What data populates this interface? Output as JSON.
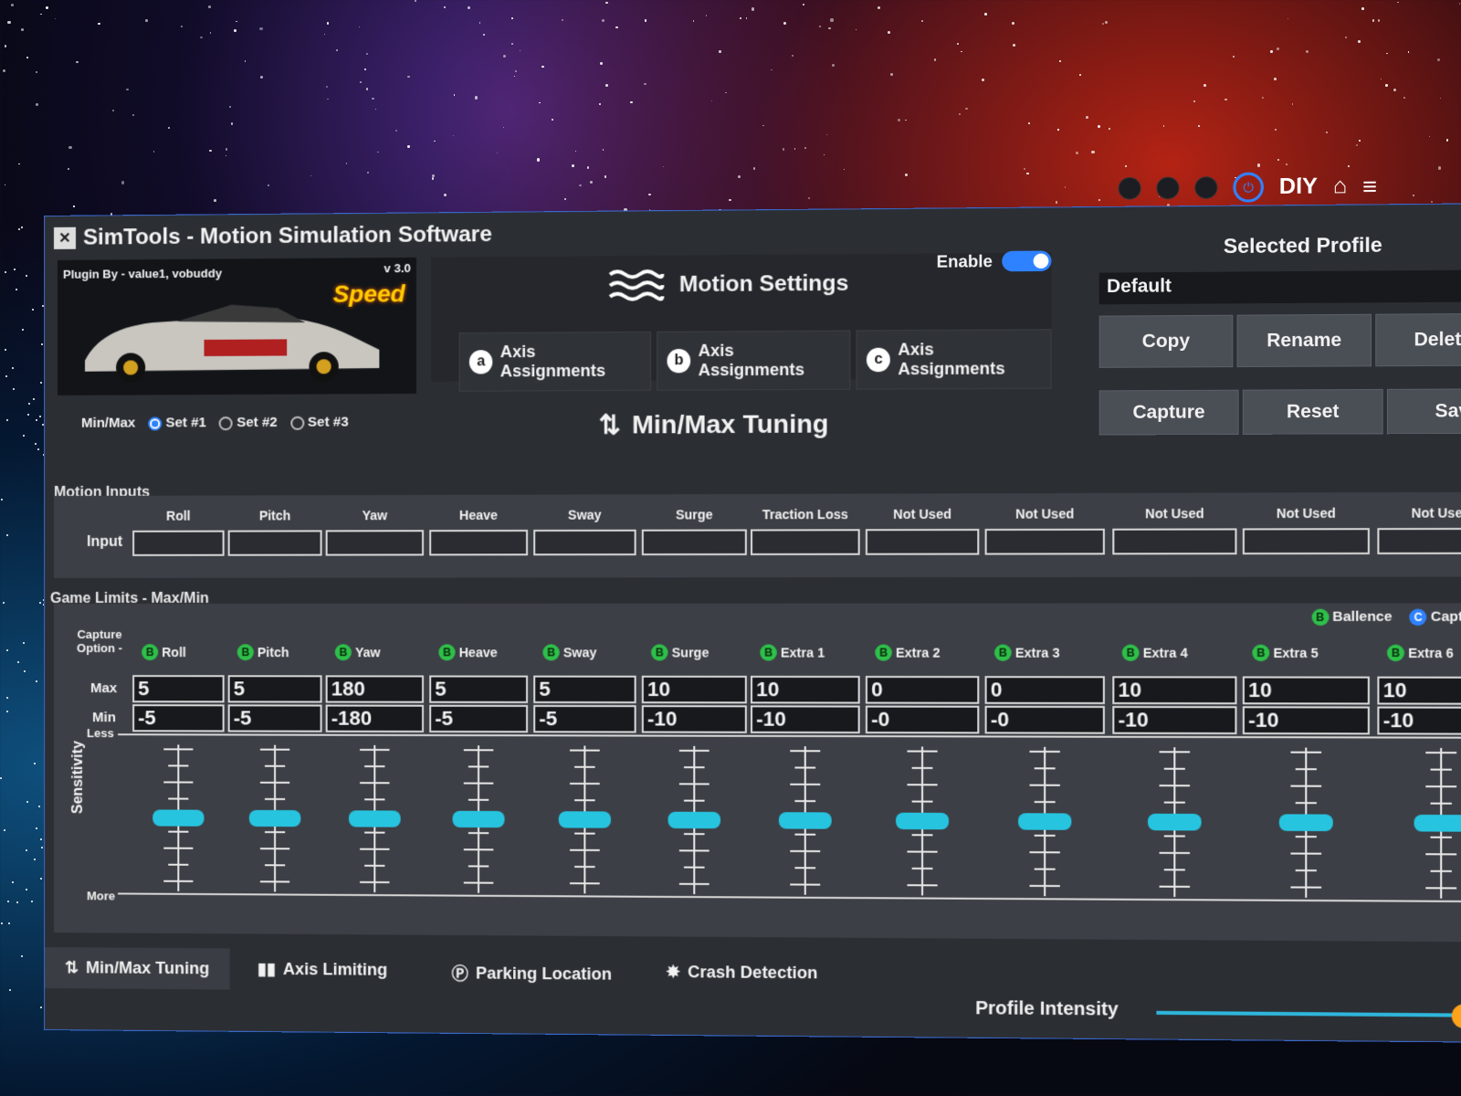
{
  "app": {
    "title": "SimTools - Motion Simulation Software",
    "topbar": {
      "diy_label": "DIY"
    }
  },
  "plugin": {
    "by": "Plugin By - value1, vobuddy",
    "version": "v 3.0",
    "game_logo": "Speed"
  },
  "motion_settings": {
    "title": "Motion Settings",
    "enable_label": "Enable",
    "enabled": true,
    "axis_tabs": [
      {
        "badge": "a",
        "label": "Axis Assignments"
      },
      {
        "badge": "b",
        "label": "Axis Assignments"
      },
      {
        "badge": "c",
        "label": "Axis Assignments"
      }
    ]
  },
  "profile": {
    "title": "Selected Profile",
    "selected": "Default",
    "buttons": [
      "Copy",
      "Rename",
      "Delete"
    ],
    "capture_buttons": [
      "Capture",
      "Reset",
      "Save"
    ]
  },
  "minmax": {
    "label": "Min/Max",
    "sets": [
      "Set #1",
      "Set #2",
      "Set #3"
    ],
    "selected_set": 0,
    "title": "Min/Max Tuning"
  },
  "motion_inputs": {
    "label": "Motion Inputs",
    "row_label": "Input",
    "columns": [
      "Roll",
      "Pitch",
      "Yaw",
      "Heave",
      "Sway",
      "Surge",
      "Traction Loss",
      "Not Used",
      "Not Used",
      "Not Used",
      "Not Used",
      "Not Used"
    ]
  },
  "game_limits": {
    "label": "Game Limits - Max/Min",
    "capture_option": "Capture Option -",
    "legend": [
      {
        "badge": "B",
        "label": "Ballence"
      },
      {
        "badge": "C",
        "label": "Capture"
      }
    ],
    "max_label": "Max",
    "min_label": "Min",
    "columns": [
      {
        "badge": "B",
        "name": "Roll",
        "max": "5",
        "min": "-5",
        "sensitivity": 0.5
      },
      {
        "badge": "B",
        "name": "Pitch",
        "max": "5",
        "min": "-5",
        "sensitivity": 0.5
      },
      {
        "badge": "B",
        "name": "Yaw",
        "max": "180",
        "min": "-180",
        "sensitivity": 0.5
      },
      {
        "badge": "B",
        "name": "Heave",
        "max": "5",
        "min": "-5",
        "sensitivity": 0.5
      },
      {
        "badge": "B",
        "name": "Sway",
        "max": "5",
        "min": "-5",
        "sensitivity": 0.5
      },
      {
        "badge": "B",
        "name": "Surge",
        "max": "10",
        "min": "-10",
        "sensitivity": 0.5
      },
      {
        "badge": "B",
        "name": "Extra 1",
        "max": "10",
        "min": "-10",
        "sensitivity": 0.5
      },
      {
        "badge": "B",
        "name": "Extra 2",
        "max": "0",
        "min": "-0",
        "sensitivity": 0.5
      },
      {
        "badge": "B",
        "name": "Extra 3",
        "max": "0",
        "min": "-0",
        "sensitivity": 0.5
      },
      {
        "badge": "B",
        "name": "Extra 4",
        "max": "10",
        "min": "-10",
        "sensitivity": 0.5
      },
      {
        "badge": "B",
        "name": "Extra 5",
        "max": "10",
        "min": "-10",
        "sensitivity": 0.5
      },
      {
        "badge": "B",
        "name": "Extra 6",
        "max": "10",
        "min": "-10",
        "sensitivity": 0.5
      }
    ],
    "sensitivity_label": "Sensitivity",
    "less_label": "Less",
    "more_label": "More"
  },
  "bottom_tabs": [
    {
      "icon": "updown-arrows-icon",
      "label": "Min/Max Tuning",
      "active": true
    },
    {
      "icon": "bars-icon",
      "label": "Axis Limiting",
      "active": false
    },
    {
      "icon": "parking-icon",
      "label": "Parking Location",
      "active": false
    },
    {
      "icon": "crash-icon",
      "label": "Crash Detection",
      "active": false
    }
  ],
  "profile_intensity": {
    "label": "Profile Intensity",
    "value": 1.0
  },
  "colors": {
    "accent": "#2f82ff",
    "slider_thumb": "#27c4e0",
    "intensity_thumb": "#ffa31a",
    "balance_badge": "#2ec04a"
  }
}
